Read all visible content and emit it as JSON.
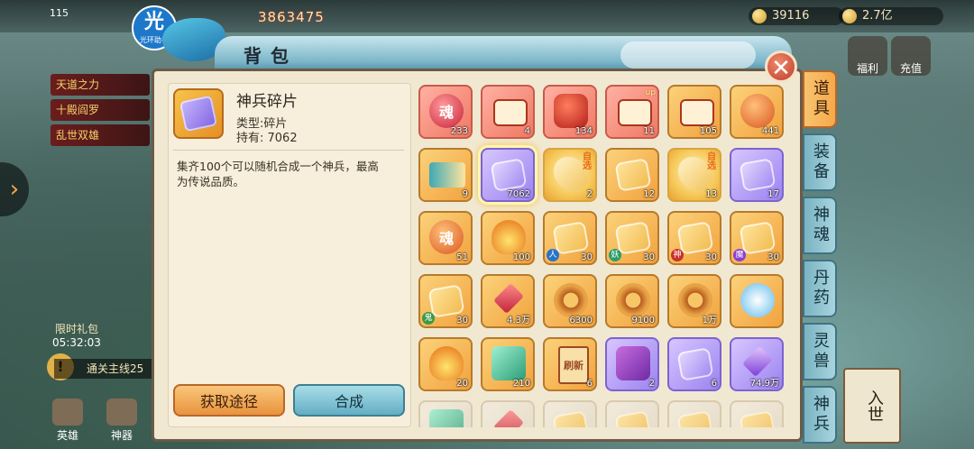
{
  "hud": {
    "level": "115",
    "power": "3863475",
    "gold": "39116",
    "currency": "2.7亿",
    "badge_char": "光",
    "badge_caption": "光环助手"
  },
  "left_side": {
    "banners": [
      "天道之力",
      "十殿阎罗",
      "乱世双雄"
    ],
    "limited_label": "限时礼包",
    "limited_timer": "05:32:03",
    "quest": "通关主线25",
    "nav": [
      "英雄",
      "神器"
    ]
  },
  "right_side": {
    "top": [
      "福利",
      "充值"
    ],
    "scroll": "入世"
  },
  "bag": {
    "title": "背包",
    "close": "✕",
    "selected": {
      "name": "神兵碎片",
      "type": "类型:碎片",
      "owned": "持有: 7062",
      "desc": "集齐100个可以随机合成一个神兵，最高为传说品质。"
    },
    "btn_get": "获取途径",
    "btn_make": "合成",
    "tabs": [
      {
        "label": "道具",
        "active": true
      },
      {
        "label": "装备",
        "active": false
      },
      {
        "label": "神魂",
        "active": false
      },
      {
        "label": "丹药",
        "active": false
      },
      {
        "label": "灵兽",
        "active": false
      },
      {
        "label": "神兵",
        "active": false
      }
    ],
    "items": [
      {
        "q": "red",
        "g": "g-orb",
        "t": "魂",
        "count": "233"
      },
      {
        "q": "red",
        "g": "g-scroll",
        "t": "",
        "count": "4"
      },
      {
        "q": "red",
        "g": "g-bag",
        "t": "",
        "count": "134"
      },
      {
        "q": "red",
        "g": "g-scroll",
        "t": "",
        "count": "11",
        "corner": "up"
      },
      {
        "q": "orange",
        "g": "g-scroll",
        "t": "",
        "count": "105"
      },
      {
        "q": "orange",
        "g": "g-orb-o",
        "t": "",
        "count": "441"
      },
      {
        "q": "orange",
        "g": "g-fan",
        "t": "",
        "count": "9"
      },
      {
        "q": "purple",
        "g": "g-piece g-piece-p",
        "t": "",
        "count": "7062",
        "selected": true
      },
      {
        "q": "gold",
        "g": "g-wing",
        "t": "",
        "count": "2",
        "zixuan": "自选"
      },
      {
        "q": "orange",
        "g": "g-piece",
        "t": "",
        "count": "12"
      },
      {
        "q": "gold",
        "g": "g-wing",
        "t": "",
        "count": "13",
        "zixuan": "自选"
      },
      {
        "q": "purple",
        "g": "g-piece g-piece-p",
        "t": "",
        "count": "17"
      },
      {
        "q": "orange",
        "g": "g-orb-o",
        "t": "魂",
        "count": "51"
      },
      {
        "q": "orange",
        "g": "g-flame",
        "t": "",
        "count": "100"
      },
      {
        "q": "orange",
        "g": "g-piece",
        "t": "",
        "count": "30",
        "tag": "人",
        "tagc": "t-ren"
      },
      {
        "q": "orange",
        "g": "g-piece",
        "t": "",
        "count": "30",
        "tag": "妖",
        "tagc": "t-yao"
      },
      {
        "q": "orange",
        "g": "g-piece",
        "t": "",
        "count": "30",
        "tag": "神",
        "tagc": "t-shen"
      },
      {
        "q": "orange",
        "g": "g-piece",
        "t": "",
        "count": "30",
        "tag": "魔",
        "tagc": "t-mo"
      },
      {
        "q": "orange",
        "g": "g-piece",
        "t": "",
        "count": "30",
        "tag": "鬼",
        "tagc": "t-gui"
      },
      {
        "q": "orange",
        "g": "g-crystal",
        "t": "",
        "count": "4.3万"
      },
      {
        "q": "orange",
        "g": "g-seal",
        "t": "",
        "count": "6300"
      },
      {
        "q": "orange",
        "g": "g-seal",
        "t": "",
        "count": "9100"
      },
      {
        "q": "orange",
        "g": "g-seal",
        "t": "",
        "count": "1万"
      },
      {
        "q": "orange",
        "g": "g-sword",
        "t": "",
        "count": ""
      },
      {
        "q": "orange",
        "g": "g-flame",
        "t": "",
        "count": "20"
      },
      {
        "q": "orange",
        "g": "g-jade",
        "t": "",
        "count": "210"
      },
      {
        "q": "orange",
        "g": "g-paper",
        "t": "刷新",
        "count": "6"
      },
      {
        "q": "purple",
        "g": "g-pouch",
        "t": "",
        "count": "2"
      },
      {
        "q": "purple",
        "g": "g-piece g-piece-p",
        "t": "",
        "count": "6"
      },
      {
        "q": "purple",
        "g": "g-crystal g-crystal-p",
        "t": "",
        "count": "74.9万"
      },
      {
        "q": "faded",
        "g": "g-jade",
        "t": "",
        "count": ""
      },
      {
        "q": "faded",
        "g": "g-crystal",
        "t": "",
        "count": ""
      },
      {
        "q": "faded",
        "g": "g-piece",
        "t": "",
        "count": ""
      },
      {
        "q": "faded",
        "g": "g-piece",
        "t": "",
        "count": ""
      },
      {
        "q": "faded",
        "g": "g-piece",
        "t": "",
        "count": ""
      },
      {
        "q": "faded",
        "g": "g-piece",
        "t": "",
        "count": ""
      }
    ]
  }
}
